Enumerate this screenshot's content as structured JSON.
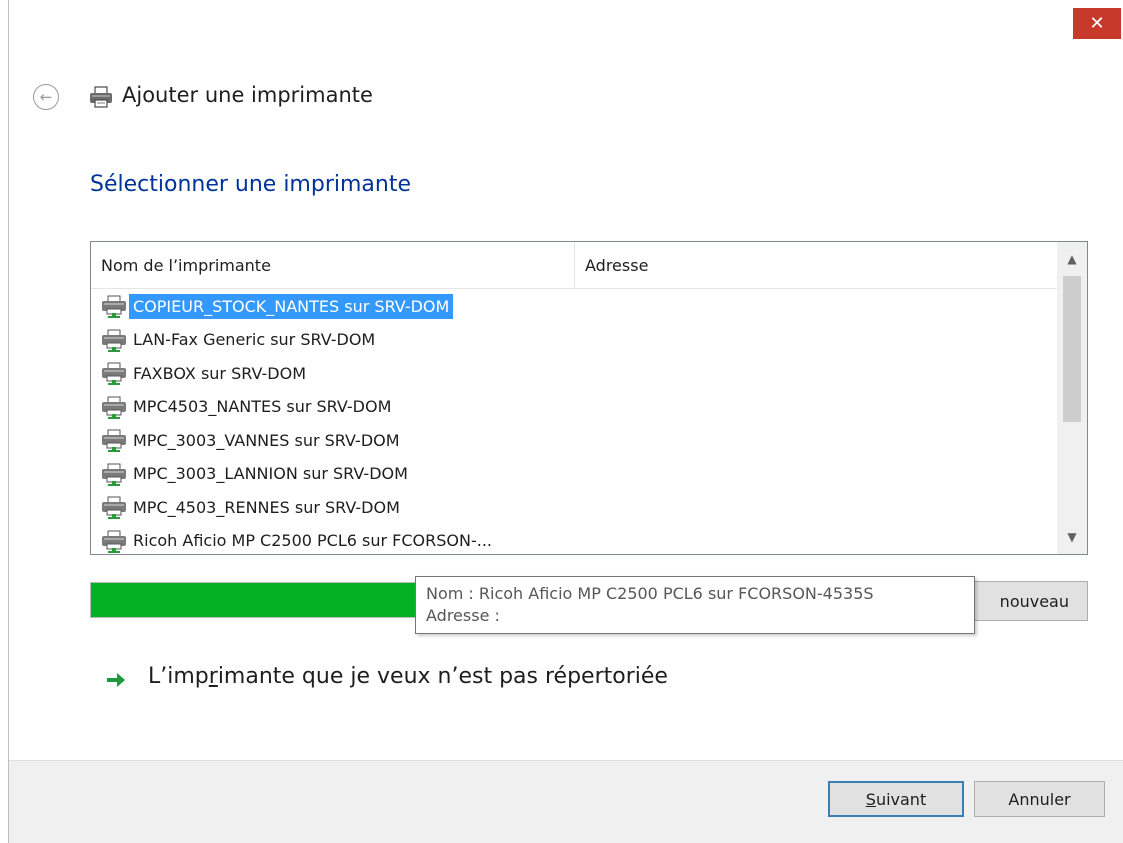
{
  "window": {
    "title": "Ajouter une imprimante",
    "close_glyph": "✕"
  },
  "back_glyph": "←",
  "heading": "Sélectionner une imprimante",
  "list": {
    "columns": [
      "Nom de l’imprimante",
      "Adresse"
    ],
    "items": [
      {
        "name": "COPIEUR_STOCK_NANTES sur SRV-DOM",
        "selected": true
      },
      {
        "name": "LAN-Fax Generic sur SRV-DOM",
        "selected": false
      },
      {
        "name": "FAXBOX sur SRV-DOM",
        "selected": false
      },
      {
        "name": "MPC4503_NANTES sur SRV-DOM",
        "selected": false
      },
      {
        "name": "MPC_3003_VANNES sur SRV-DOM",
        "selected": false
      },
      {
        "name": "MPC_3003_LANNION sur SRV-DOM",
        "selected": false
      },
      {
        "name": "MPC_4503_RENNES sur SRV-DOM",
        "selected": false
      },
      {
        "name": "Ricoh Aficio MP C2500 PCL6 sur FCORSON-...",
        "selected": false
      }
    ],
    "scroll_up_glyph": "▲",
    "scroll_down_glyph": "▼"
  },
  "progress": {
    "fraction": 1.0,
    "color": "#06b025"
  },
  "search_again_partial_label": "nouveau",
  "tooltip": {
    "line1": "Nom : Ricoh Aficio MP C2500 PCL6 sur FCORSON-4535S",
    "line2": "Adresse :"
  },
  "link": {
    "text_before": "L’imp",
    "text_underlined": "r",
    "text_after": "imante que je veux n’est pas répertoriée"
  },
  "buttons": {
    "next_underlined": "S",
    "next_rest": "uivant",
    "cancel": "Annuler"
  },
  "colors": {
    "close_button": "#c7392b",
    "heading": "#003399",
    "selection": "#3399ff",
    "link_arrow": "#1a9a3a"
  }
}
